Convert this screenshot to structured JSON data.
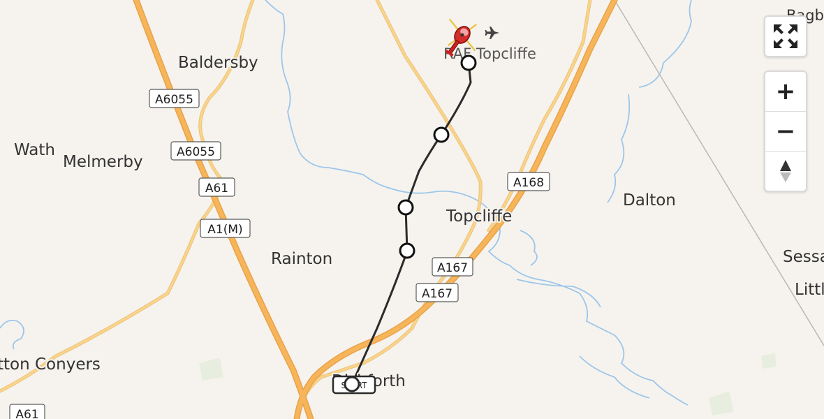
{
  "map": {
    "colors": {
      "land": "#f6f3ee",
      "motorway": "#f7b55a",
      "primary": "#fbd38b",
      "water": "#9cc6ea",
      "route": "#2b2b2b",
      "marker_fill": "#ffffff"
    },
    "places": {
      "baldersby": "Baldersby",
      "wath": "Wath",
      "melmerby": "Melmerby",
      "rainton": "Rainton",
      "topcliffe": "Topcliffe",
      "dalton": "Dalton",
      "dishforth": "Dishforth",
      "raf_topcliffe": "RAF Topcliffe",
      "sessay": "Sessa",
      "little": "Littl",
      "bagby": "Bagb",
      "sutton_conyers": "tton Conyers"
    },
    "road_labels": {
      "a6055_1": "A6055",
      "a6055_2": "A6055",
      "a61_1": "A61",
      "a1m": "A1(M)",
      "a168": "A168",
      "a167_1": "A167",
      "a167_2": "A167",
      "a61_2": "A61"
    },
    "route": {
      "start_label": "START",
      "waypoint_count": 5
    },
    "icons": {
      "destination": "helicopter-icon",
      "airport": "airplane-icon"
    }
  },
  "controls": {
    "fullscreen": "fullscreen-icon",
    "zoom_in": "+",
    "zoom_out": "−",
    "reset_north": "compass-icon"
  }
}
